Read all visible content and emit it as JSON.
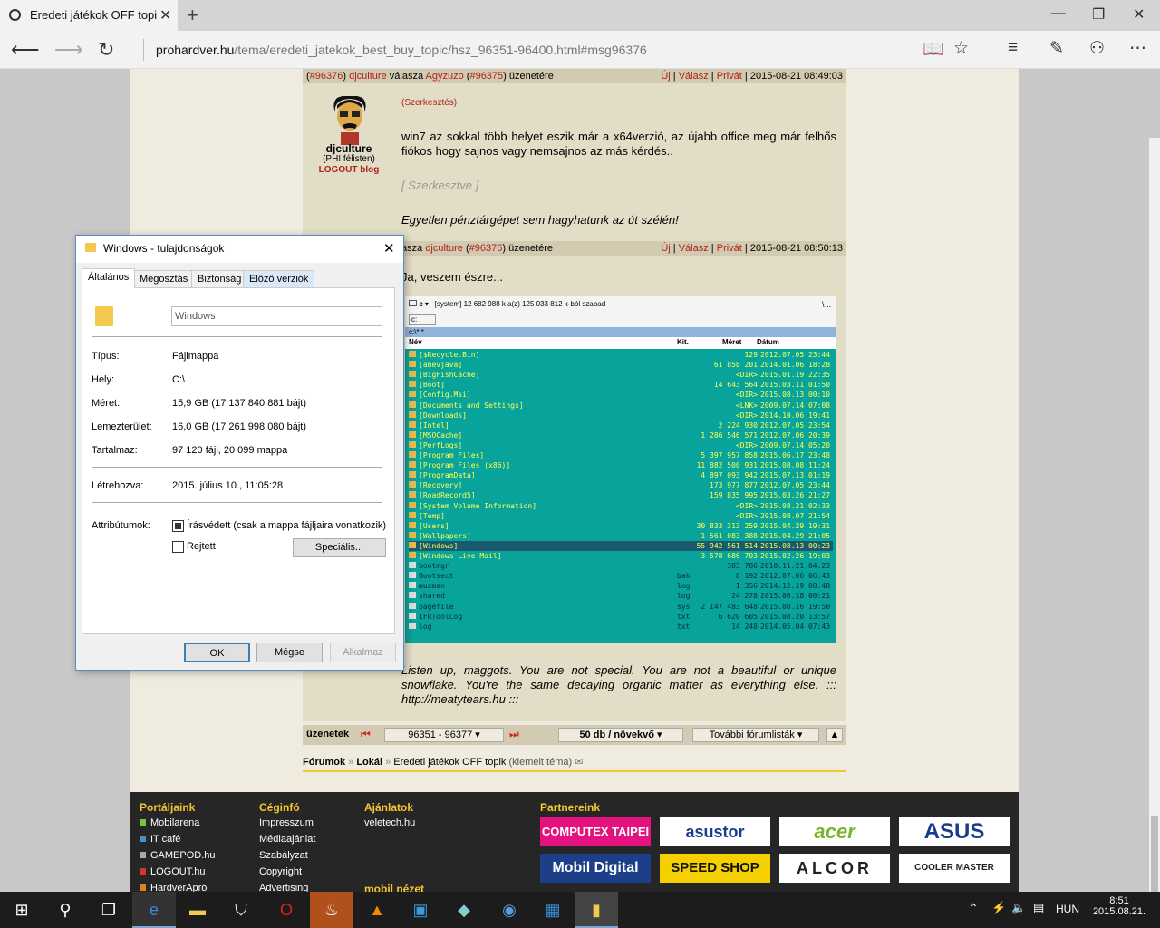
{
  "browser": {
    "tab_title": "Eredeti játékok OFF topi",
    "new_tab": "+",
    "address_domain": "prohardver.hu",
    "address_path": "/tema/eredeti_jatekok_best_buy_topic/hsz_96351-96400.html#msg96376"
  },
  "post1": {
    "hdr_num": "#96376",
    "hdr_user": "djculture",
    "hdr_reply": "válasza",
    "hdr_to": "Agyzuzo",
    "hdr_to_num": "#96375",
    "hdr_suffix": "üzenetére",
    "links": [
      "Új",
      "Válasz",
      "Privát"
    ],
    "date": "2015-08-21 08:49:03",
    "author": "djculture",
    "author_role": "(PH! félisten)",
    "author_blog": "LOGOUT blog",
    "edit_link": "(Szerkesztés)",
    "body": "win7 az sokkal több helyet eszik már a x64verzió, az újabb office meg már felhős fiókos hogy sajnos vagy nemsajnos az más kérdés..",
    "edited": "[ Szerkesztve ]",
    "signature": "Egyetlen pénztárgépet sem hagyhatunk az út szélén!"
  },
  "post2": {
    "hdr_prefix": "asza",
    "hdr_to": "djculture",
    "hdr_to_num": "#96376",
    "hdr_suffix": "üzenetére",
    "links": [
      "Új",
      "Válasz",
      "Privát"
    ],
    "date": "2015-08-21 08:50:13",
    "body": "Ja, veszem észre...",
    "signature": "Listen up, maggots. You are not special. You are not a beautiful or unique snowflake. You're the same decaying organic matter as everything else. ::: http://meatytears.hu :::"
  },
  "screenshot": {
    "drive": "c",
    "drive_info": "[system]  12 682 988 k a(z) 125 033 812 k-ból szabad",
    "path_tab": "c:",
    "path": "c:\\*.*",
    "col_name": "Név",
    "col_ext": "Kit.",
    "col_size": "Méret",
    "col_date": "Dátum",
    "rows": [
      {
        "name": "[$Recycle.Bin]",
        "ext": "",
        "size": "129",
        "date": "2012.07.05 23:44"
      },
      {
        "name": "[abevjava]",
        "ext": "",
        "size": "61 858 201",
        "date": "2014.01.06 18:28"
      },
      {
        "name": "[BigFishCache]",
        "ext": "",
        "size": "<DIR>",
        "date": "2015.01.19 22:35"
      },
      {
        "name": "[Boot]",
        "ext": "",
        "size": "14 643 564",
        "date": "2015.03.11 01:50"
      },
      {
        "name": "[Config.Msi]",
        "ext": "",
        "size": "<DIR>",
        "date": "2015.08.13 00:10"
      },
      {
        "name": "[Documents and Settings]",
        "ext": "",
        "size": "<LNK>",
        "date": "2009.07.14 07:08"
      },
      {
        "name": "[Downloads]",
        "ext": "",
        "size": "<DIR>",
        "date": "2014.10.06 19:41"
      },
      {
        "name": "[Intel]",
        "ext": "",
        "size": "2 224 930",
        "date": "2012.07.05 23:54"
      },
      {
        "name": "[MSOCache]",
        "ext": "",
        "size": "1 286 546 571",
        "date": "2012.07.06 20:39"
      },
      {
        "name": "[PerfLogs]",
        "ext": "",
        "size": "<DIR>",
        "date": "2009.07.14 05:20"
      },
      {
        "name": "[Program Files]",
        "ext": "",
        "size": "5 397 957 858",
        "date": "2015.06.17 23:48"
      },
      {
        "name": "[Program Files (x86)]",
        "ext": "",
        "size": "11 882 500 931",
        "date": "2015.08.08 11:24"
      },
      {
        "name": "[ProgramData]",
        "ext": "",
        "size": "4 897 093 942",
        "date": "2015.07.13 01:19"
      },
      {
        "name": "[Recovery]",
        "ext": "",
        "size": "173 977 877",
        "date": "2012.07.05 23:44"
      },
      {
        "name": "[RoadRecord5]",
        "ext": "",
        "size": "159 835 995",
        "date": "2015.03.26 21:27"
      },
      {
        "name": "[System Volume Information]",
        "ext": "",
        "size": "<DIR>",
        "date": "2015.08.21 02:33"
      },
      {
        "name": "[Temp]",
        "ext": "",
        "size": "<DIR>",
        "date": "2015.08.07 21:54"
      },
      {
        "name": "[Users]",
        "ext": "",
        "size": "30 833 313 259",
        "date": "2015.04.29 19:31"
      },
      {
        "name": "[Wallpapers]",
        "ext": "",
        "size": "1 561 083 388",
        "date": "2015.04.29 21:05"
      },
      {
        "name": "[Windows]",
        "ext": "",
        "size": "55 942 561 514",
        "date": "2015.08.13 00:23"
      },
      {
        "name": "[Windows Live Mail]",
        "ext": "",
        "size": "3 578 686 703",
        "date": "2015.02.26 19:03"
      },
      {
        "name": "bootmgr",
        "ext": "",
        "size": "383 786",
        "date": "2010.11.21 04:23"
      },
      {
        "name": "Bootsect",
        "ext": "bak",
        "size": "8 192",
        "date": "2012.07.06 06:43"
      },
      {
        "name": "muxman",
        "ext": "log",
        "size": "1 356",
        "date": "2014.12.19 08:48"
      },
      {
        "name": "shared",
        "ext": "log",
        "size": "24 278",
        "date": "2015.06.18 00:21"
      },
      {
        "name": "pagefile",
        "ext": "sys",
        "size": "2 147 483 648",
        "date": "2015.08.16 19:50"
      },
      {
        "name": "IFRToolLog",
        "ext": "txt",
        "size": "6 620 605",
        "date": "2015.08.20 13:57"
      },
      {
        "name": "log",
        "ext": "txt",
        "size": "14 248",
        "date": "2014.05.04 07:43"
      }
    ]
  },
  "pagination": {
    "label": "üzenetek",
    "range": "96351 - 96377",
    "per_page": "50 db / növekvő",
    "more": "További fórumlisták"
  },
  "breadcrumb": [
    "Fórumok",
    "Lokál",
    "Eredeti játékok OFF topik"
  ],
  "breadcrumb_note": "(kiemelt téma)",
  "footer": {
    "col1_title": "Portáljaink",
    "col1": [
      {
        "label": "Mobilarena",
        "color": "#7ac142"
      },
      {
        "label": "IT café",
        "color": "#4a90c8"
      },
      {
        "label": "GAMEPOD.hu",
        "color": "#aaaaaa"
      },
      {
        "label": "LOGOUT.hu",
        "color": "#d9342b"
      },
      {
        "label": "HardverApró",
        "color": "#e0801f"
      }
    ],
    "col2_title": "Céginfó",
    "col2": [
      "Impresszum",
      "Médiaajánlat",
      "Szabályzat",
      "Copyright",
      "Advertising"
    ],
    "col3_title": "Ajánlatok",
    "col3": [
      "veletech.hu"
    ],
    "col3b": "mobil nézet",
    "partners_title": "Partnereink",
    "partners": [
      "COMPUTEX TAIPEI",
      "asustor",
      "acer",
      "ASUS",
      "Mobil Digital",
      "SPEED SHOP",
      "ALCOR",
      "COOLER MASTER"
    ]
  },
  "dialog": {
    "title": "Windows - tulajdonságok",
    "tabs": [
      "Általános",
      "Megosztás",
      "Biztonság",
      "Előző verziók"
    ],
    "name_value": "Windows",
    "rows": [
      {
        "label": "Típus:",
        "value": "Fájlmappa"
      },
      {
        "label": "Hely:",
        "value": "C:\\"
      },
      {
        "label": "Méret:",
        "value": "15,9 GB (17 137 840 881 bájt)"
      },
      {
        "label": "Lemezterület:",
        "value": "16,0 GB (17 261 998 080 bájt)"
      },
      {
        "label": "Tartalmaz:",
        "value": "97 120 fájl, 20 099 mappa"
      }
    ],
    "created_label": "Létrehozva:",
    "created_value": "2015. július 10., 11:05:28",
    "attr_label": "Attribútumok:",
    "readonly_label": "Írásvédett (csak a mappa fájljaira vonatkozik)",
    "hidden_label": "Rejtett",
    "special_button": "Speciális...",
    "ok": "OK",
    "cancel": "Mégse",
    "apply": "Alkalmaz"
  },
  "taskbar": {
    "lang": "HUN",
    "time": "8:51",
    "date": "2015.08.21."
  }
}
